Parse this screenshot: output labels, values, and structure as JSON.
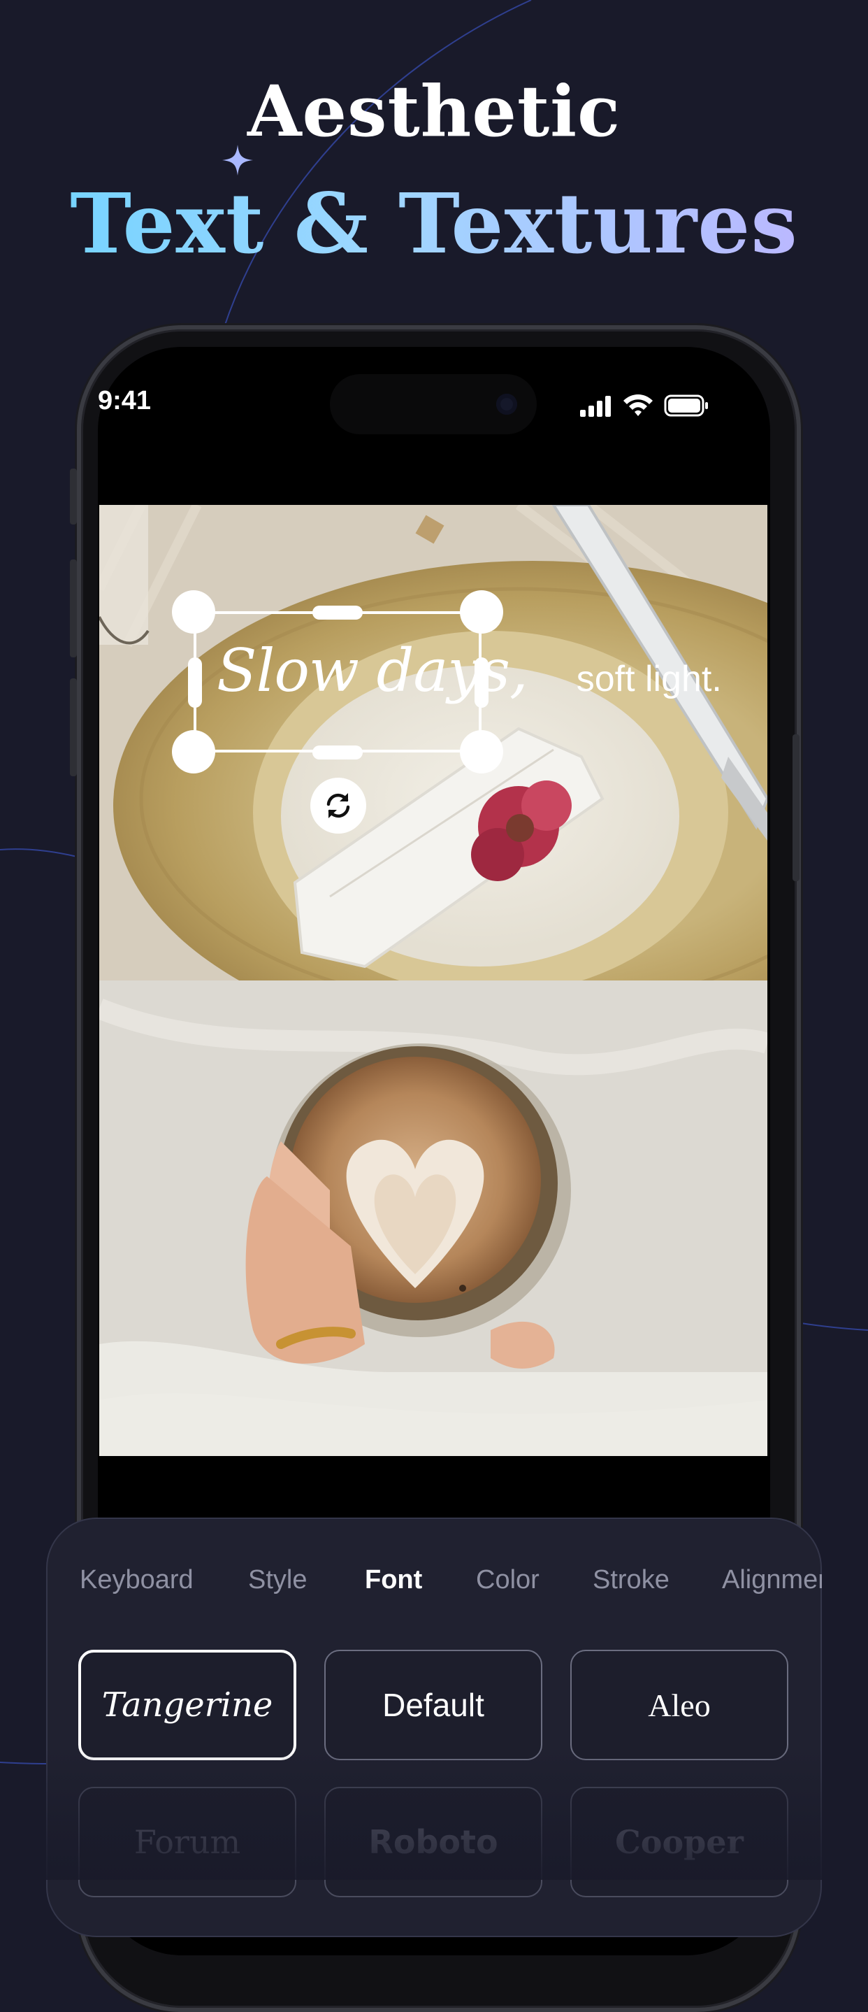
{
  "headline": {
    "line1": "Aesthetic",
    "line2": "Text & Textures"
  },
  "status_bar": {
    "time": "9:41"
  },
  "editor": {
    "text_line_part1": "Slow days,",
    "text_line_part2": "soft light."
  },
  "tabs": [
    {
      "label": "Keyboard",
      "active": false
    },
    {
      "label": "Style",
      "active": false
    },
    {
      "label": "Font",
      "active": true
    },
    {
      "label": "Color",
      "active": false
    },
    {
      "label": "Stroke",
      "active": false
    },
    {
      "label": "Alignment",
      "active": false
    }
  ],
  "fonts": [
    {
      "name": "Tangerine",
      "selected": true
    },
    {
      "name": "Default",
      "selected": false
    },
    {
      "name": "Aleo",
      "selected": false
    },
    {
      "name": "Forum",
      "selected": false
    },
    {
      "name": "Roboto",
      "selected": false
    },
    {
      "name": "Cooper",
      "selected": false
    }
  ],
  "colors": {
    "background": "#191a2a",
    "headline_gradient_start": "#6fd3ff",
    "headline_gradient_end": "#bfb3ff",
    "panel": "#202130",
    "tab_inactive": "#8f91a3"
  }
}
